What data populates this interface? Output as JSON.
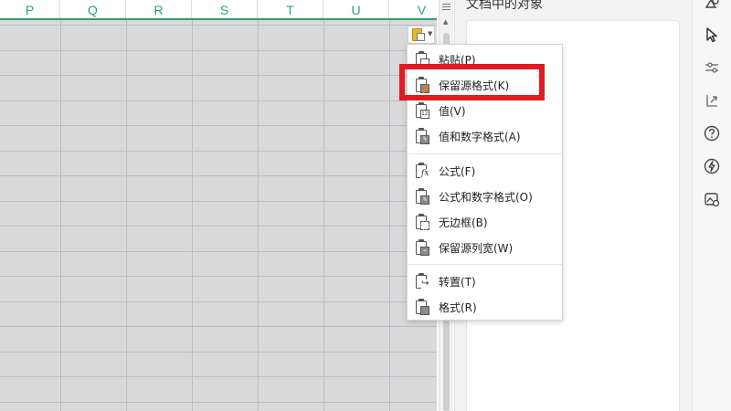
{
  "sheet": {
    "columns": [
      "P",
      "Q",
      "R",
      "S",
      "T",
      "U",
      "V"
    ],
    "header_color": "#2aa36a",
    "cell_fill": "#d9d9d9"
  },
  "paste_options_button": {
    "icon": "clipboard-icon"
  },
  "object_pane": {
    "title": "文档中的对象"
  },
  "paste_menu": {
    "items": [
      {
        "label": "粘贴(P)",
        "icon": "paste-icon"
      },
      {
        "label": "保留源格式(K)",
        "icon": "keep-source-format-icon"
      },
      {
        "label": "值(V)",
        "icon": "paste-values-icon"
      },
      {
        "label": "值和数字格式(A)",
        "icon": "values-number-format-icon"
      },
      {
        "label": "公式(F)",
        "icon": "paste-formula-icon"
      },
      {
        "label": "公式和数字格式(O)",
        "icon": "formula-number-format-icon"
      },
      {
        "label": "无边框(B)",
        "icon": "no-borders-icon"
      },
      {
        "label": "保留源列宽(W)",
        "icon": "keep-column-width-icon"
      },
      {
        "label": "转置(T)",
        "icon": "transpose-icon"
      },
      {
        "label": "格式(R)",
        "icon": "paste-formatting-icon"
      }
    ]
  },
  "toolbar_icons": [
    "shapes-icon",
    "select-pointer-icon",
    "adjust-icon",
    "resize-icon",
    "help-icon",
    "flash-icon",
    "image-tool-icon"
  ],
  "highlight_color": "#e11b22"
}
